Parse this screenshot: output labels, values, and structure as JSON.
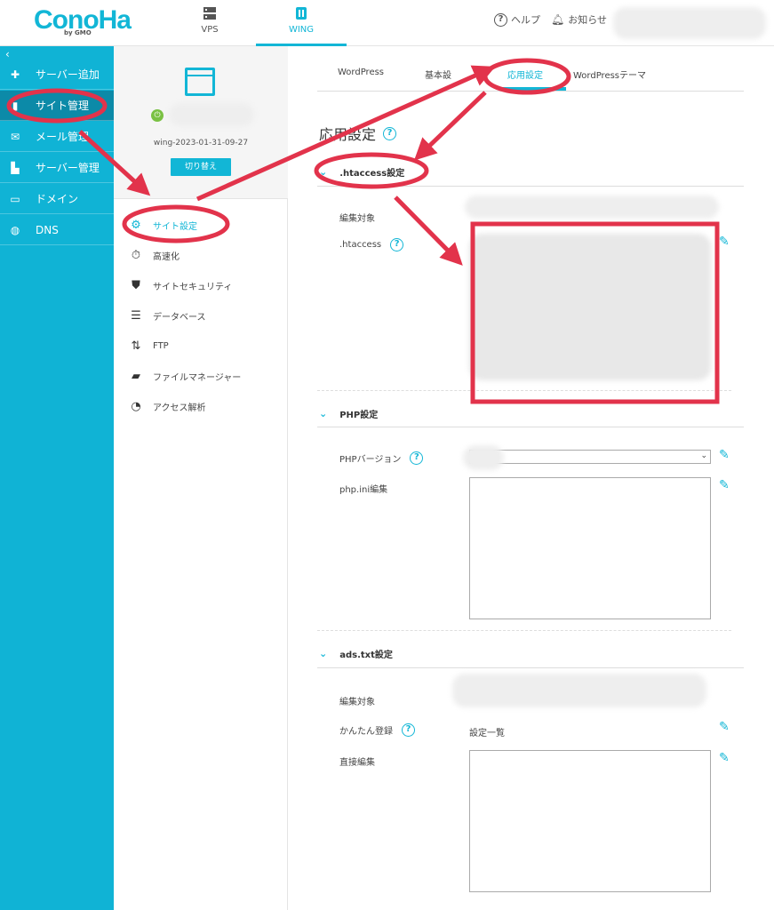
{
  "header": {
    "logo": "ConoHa",
    "logo_sub": "by GMO",
    "tabs": [
      {
        "label": "VPS",
        "icon": "server-icon",
        "active": false
      },
      {
        "label": "WING",
        "icon": "wing-icon",
        "active": true
      }
    ],
    "help_label": "ヘルプ",
    "notice_label": "お知らせ"
  },
  "sidebar": {
    "collapse_icon": "‹",
    "items": [
      {
        "label": "サーバー追加",
        "icon": "plus-icon",
        "active": false
      },
      {
        "label": "サイト管理",
        "icon": "site-icon",
        "active": true
      },
      {
        "label": "メール管理",
        "icon": "mail-icon",
        "active": false
      },
      {
        "label": "サーバー管理",
        "icon": "server-manage-icon",
        "active": false
      },
      {
        "label": "ドメイン",
        "icon": "domain-icon",
        "active": false
      },
      {
        "label": "DNS",
        "icon": "globe-icon",
        "active": false
      }
    ]
  },
  "site_panel": {
    "site_name": "wing-2023-01-31-09-27",
    "switch_label": "切り替え",
    "menu": [
      {
        "label": "サイト設定",
        "icon": "site-settings-icon",
        "active": true
      },
      {
        "label": "高速化",
        "icon": "stopwatch-icon",
        "active": false
      },
      {
        "label": "サイトセキュリティ",
        "icon": "shield-icon",
        "active": false
      },
      {
        "label": "データベース",
        "icon": "database-icon",
        "active": false
      },
      {
        "label": "FTP",
        "icon": "transfer-icon",
        "active": false
      },
      {
        "label": "ファイルマネージャー",
        "icon": "folder-icon",
        "active": false
      },
      {
        "label": "アクセス解析",
        "icon": "pie-chart-icon",
        "active": false
      }
    ]
  },
  "content_tabs": [
    {
      "label": "WordPress",
      "active": false
    },
    {
      "label": "基本設",
      "active": false
    },
    {
      "label": "応用設定",
      "active": true
    },
    {
      "label": "WordPressテーマ",
      "active": false
    }
  ],
  "section_title": "応用設定",
  "htaccess": {
    "heading": ".htaccess設定",
    "edit_target_label": "編集対象",
    "field_label": ".htaccess"
  },
  "php": {
    "heading": "PHP設定",
    "version_label": "PHPバージョン",
    "ini_label": "php.ini編集"
  },
  "ads": {
    "heading": "ads.txt設定",
    "edit_target_label": "編集対象",
    "easy_label": "かんたん登録",
    "easy_value": "設定一覧",
    "direct_label": "直接編集"
  },
  "colors": {
    "accent": "#12b6d6",
    "sidebar_bg": "#10b3d5",
    "annotation": "#e2334b"
  }
}
